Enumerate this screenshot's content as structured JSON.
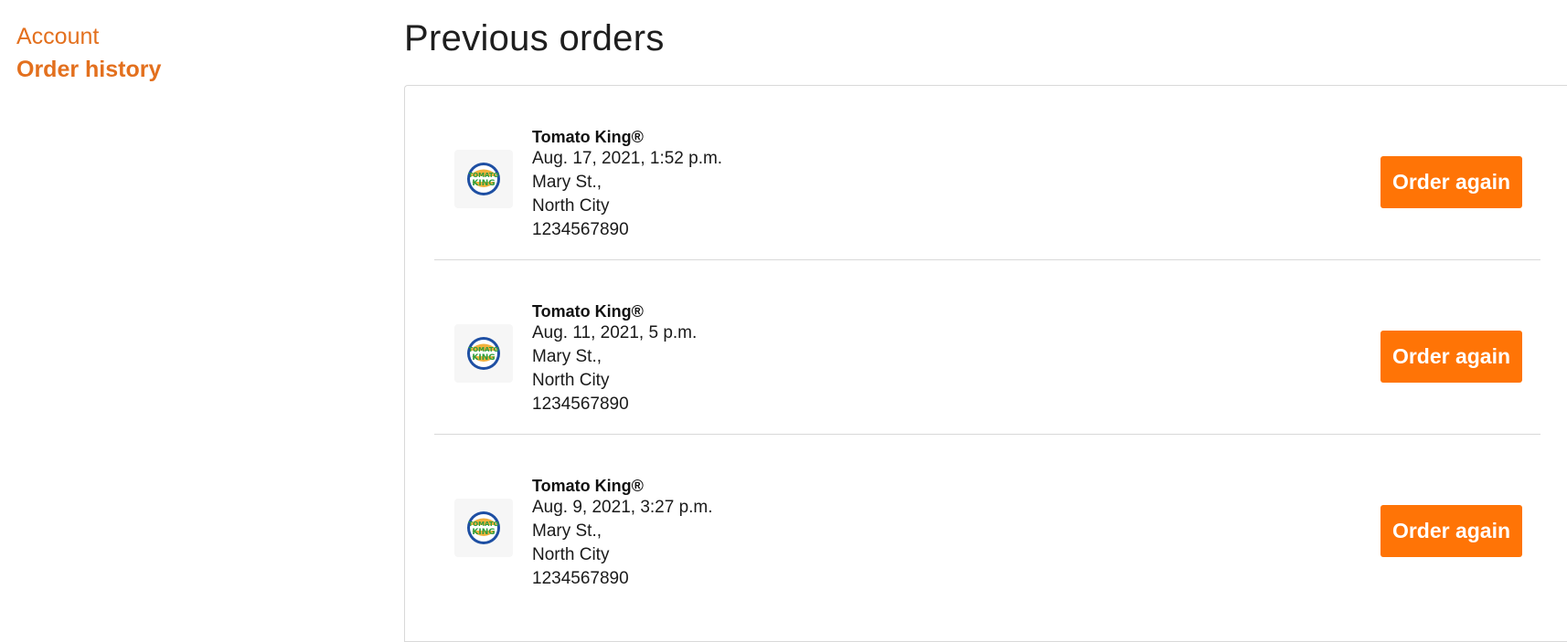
{
  "sidebar": {
    "items": [
      {
        "label": "Account",
        "active": false
      },
      {
        "label": "Order history",
        "active": true
      }
    ]
  },
  "main": {
    "title": "Previous orders",
    "orders": [
      {
        "restaurant": "Tomato King®",
        "datetime": "Aug. 17, 2021, 1:52 p.m.",
        "street": "Mary St.,",
        "city": "North City",
        "phone": "1234567890",
        "button_label": "Order again",
        "logo_icon": "tomato-king-logo"
      },
      {
        "restaurant": "Tomato King®",
        "datetime": "Aug. 11, 2021, 5 p.m.",
        "street": "Mary St.,",
        "city": "North City",
        "phone": "1234567890",
        "button_label": "Order again",
        "logo_icon": "tomato-king-logo"
      },
      {
        "restaurant": "Tomato King®",
        "datetime": "Aug. 9, 2021, 3:27 p.m.",
        "street": "Mary St.,",
        "city": "North City",
        "phone": "1234567890",
        "button_label": "Order again",
        "logo_icon": "tomato-king-logo"
      }
    ]
  },
  "colors": {
    "accent": "#e3701e",
    "button": "#ff7406",
    "divider": "#d9d9d9"
  }
}
